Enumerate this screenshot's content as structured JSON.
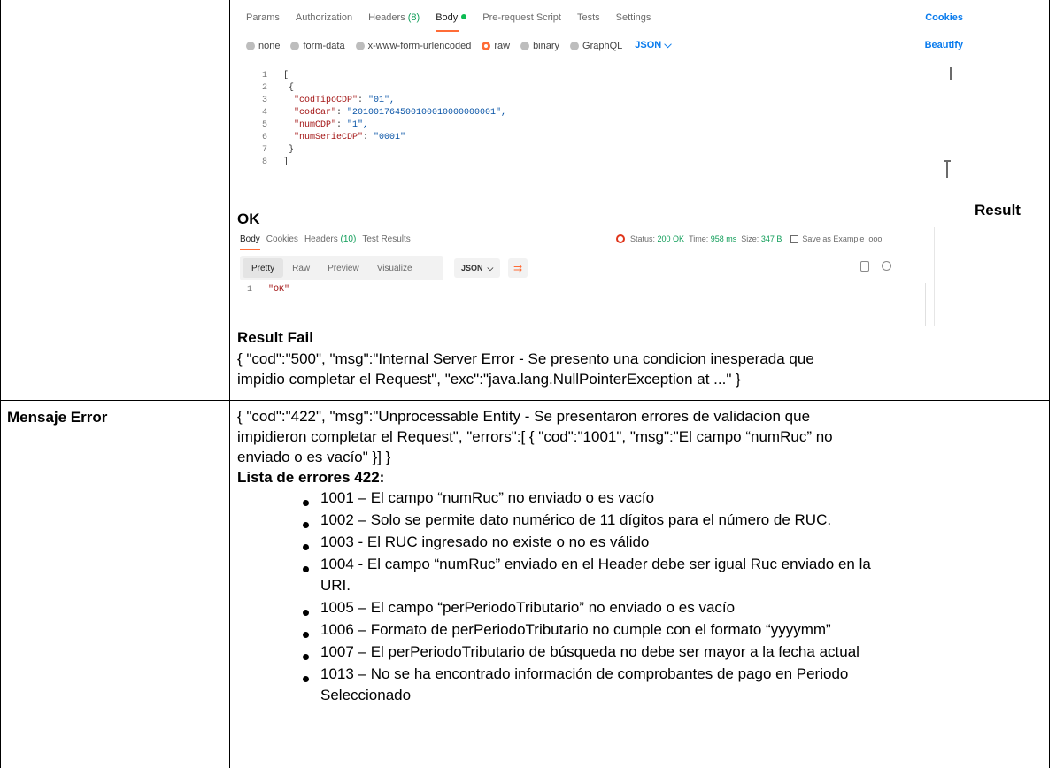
{
  "request": {
    "tabs": [
      "Params",
      "Authorization",
      "Headers",
      "Body",
      "Pre-request Script",
      "Tests",
      "Settings"
    ],
    "headers_count": "(8)",
    "cookies_label": "Cookies",
    "body_types": [
      "none",
      "form-data",
      "x-www-form-urlencoded",
      "raw",
      "binary",
      "GraphQL"
    ],
    "format_label": "JSON",
    "format_chevron": "⌵",
    "beautify_label": "Beautify",
    "lines": [
      {
        "n": "1",
        "text": "["
      },
      {
        "n": "2",
        "text": "{"
      },
      {
        "n": "3",
        "key": "\"codTipoCDP\"",
        "value": "\"01\","
      },
      {
        "n": "4",
        "key": "\"codCar\"",
        "value": "\"201001764500100010000000001\","
      },
      {
        "n": "5",
        "key": "\"numCDP\"",
        "value": "\"1\","
      },
      {
        "n": "6",
        "key": "\"numSerieCDP\"",
        "value": "\"0001\""
      },
      {
        "n": "7",
        "text": "}"
      },
      {
        "n": "8",
        "text": "]"
      }
    ]
  },
  "result_ok_heading_1": "Result",
  "result_ok_heading_2": "OK",
  "response": {
    "tabs": [
      "Body",
      "Cookies",
      "Headers",
      "Test Results"
    ],
    "headers_count": "(10)",
    "status_label": "Status:",
    "status_value": "200 OK",
    "time_label": "Time:",
    "time_value": "958 ms",
    "size_label": "Size:",
    "size_value": "347 B",
    "save_label": "Save as Example",
    "more_label": "ooo",
    "view_modes": [
      "Pretty",
      "Raw",
      "Preview",
      "Visualize"
    ],
    "format_label": "JSON",
    "format_chevron": "⌵",
    "wrap_glyph": "⇉",
    "line_number": "1",
    "line_value": "\"OK\""
  },
  "result_fail_heading": "Result Fail",
  "result_fail_lines": [
    "{ \"cod\":\"500\", \"msg\":\"Internal Server Error - Se presento una condicion inesperada que",
    "impidio completar el Request\", \"exc\":\"java.lang.NullPointerException at ...\" }"
  ],
  "mensaje_error_label": "Mensaje Error",
  "mensaje_error_lines": [
    "{ \"cod\":\"422\", \"msg\":\"Unprocessable Entity - Se presentaron errores de validacion que",
    "impidieron completar el Request\", \"errors\":[ { \"cod\":\"1001\", \"msg\":\"El campo “numRuc” no",
    "enviado o es vacío\" }] }"
  ],
  "errores_heading": "Lista de errores 422:",
  "errores": [
    [
      "1001 – El campo “numRuc” no enviado o es vacío"
    ],
    [
      "1002 – Solo se permite dato numérico de 11 dígitos para el número de RUC."
    ],
    [
      "1003 - El RUC ingresado no existe o no es válido"
    ],
    [
      "1004 - El campo “numRuc” enviado en el Header debe ser igual Ruc enviado en la",
      "URI."
    ],
    [
      "1005 – El campo “perPeriodoTributario” no enviado o es vacío"
    ],
    [
      "1006 – Formato de perPeriodoTributario no cumple con el formato “yyyymm”"
    ],
    [
      "1007 – El perPeriodoTributario de búsqueda no debe ser mayor a la fecha actual"
    ],
    [
      "1013 – No se ha encontrado información de comprobantes de pago en Periodo",
      "Seleccionado"
    ]
  ]
}
